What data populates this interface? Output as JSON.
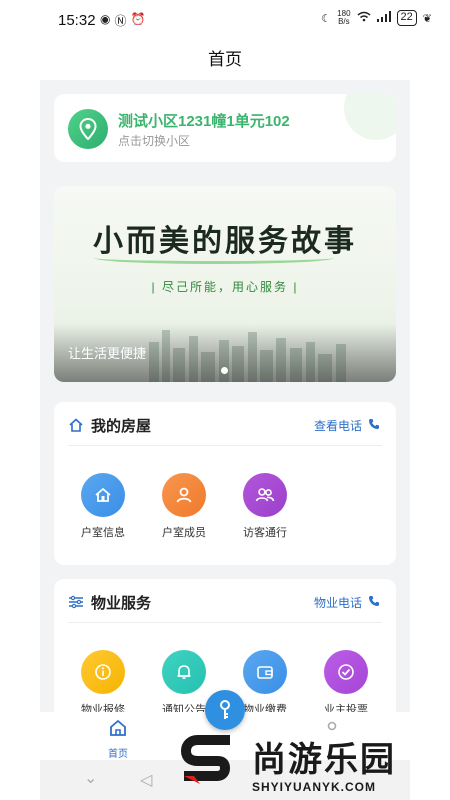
{
  "status_bar": {
    "time": "15:32",
    "net_speed_value": "180",
    "net_speed_unit": "B/s",
    "battery": "22"
  },
  "header": {
    "title": "首页"
  },
  "location": {
    "name": "测试小区1231幢1单元102",
    "hint": "点击切换小区"
  },
  "banner": {
    "headline": "小而美的服务故事",
    "tagline": "| 尽己所能，用心服务 |",
    "caption": "让生活更便捷"
  },
  "my_house": {
    "title": "我的房屋",
    "link_label": "查看电话",
    "items": [
      {
        "label": "户室信息",
        "color": "#3a8ee6",
        "icon": "house-icon"
      },
      {
        "label": "户室成员",
        "color": "#f07a2c",
        "icon": "person-icon"
      },
      {
        "label": "访客通行",
        "color": "#9b3fc9",
        "icon": "people-icon"
      }
    ]
  },
  "property_service": {
    "title": "物业服务",
    "link_label": "物业电话",
    "items": [
      {
        "label": "物业报修",
        "color": "#f5b400",
        "icon": "info-icon"
      },
      {
        "label": "通知公告",
        "color": "#26c0b0",
        "icon": "bell-icon"
      },
      {
        "label": "物业缴费",
        "color": "#3a8ee6",
        "icon": "wallet-icon"
      },
      {
        "label": "业主投票",
        "color": "#a545d6",
        "icon": "check-icon"
      }
    ]
  },
  "tabbar": {
    "home_label": "首页"
  },
  "watermark": {
    "cn": "尚游乐园",
    "en": "SHYIYUANYK.COM"
  },
  "colors": {
    "accent_green": "#3cb46e",
    "link_blue": "#2f6fc7"
  }
}
